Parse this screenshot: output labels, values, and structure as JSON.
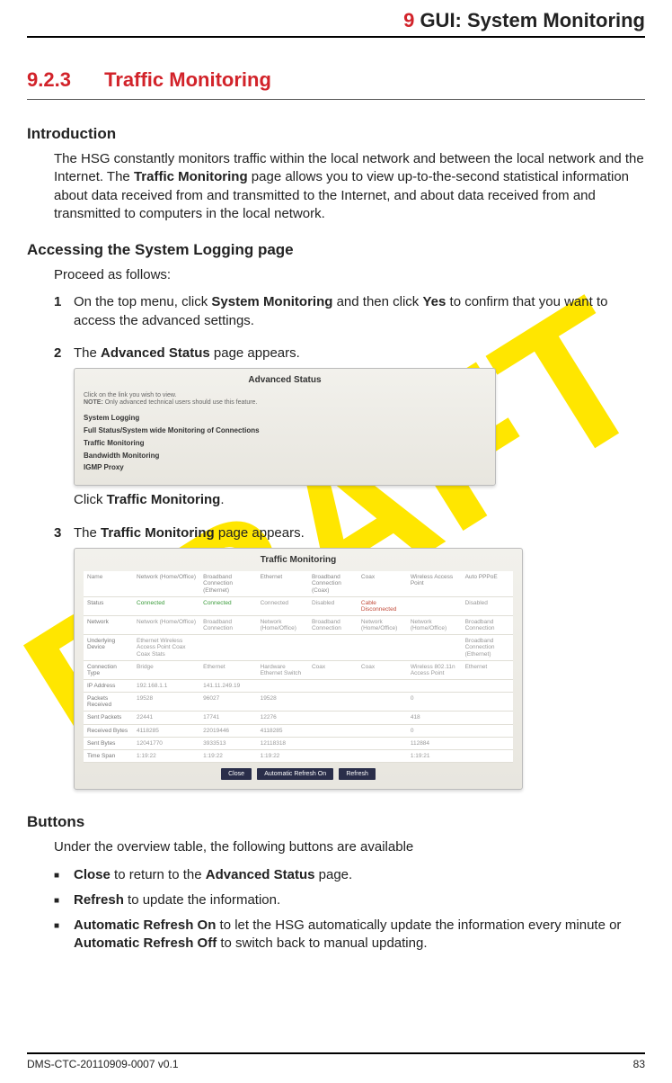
{
  "watermark": "DRAFT",
  "chapter": {
    "num": "9",
    "title": "GUI: System Monitoring"
  },
  "section": {
    "num": "9.2.3",
    "title": "Traffic Monitoring"
  },
  "intro": {
    "heading": "Introduction",
    "p1a": "The HSG constantly monitors traffic within the local network and between the local network and the Internet. The ",
    "p1b": "Traffic Monitoring",
    "p1c": " page allows you to view up-to-the-second statistical information about data received from and transmitted to the Internet, and about data received from and transmitted to computers in the local network."
  },
  "accessing": {
    "heading": "Accessing the System Logging page",
    "lead": "Proceed as follows:",
    "step1a": "On the top menu, click ",
    "step1b": "System Monitoring",
    "step1c": " and then click ",
    "step1d": "Yes",
    "step1e": " to confirm that you want to access the advanced settings.",
    "step2a": "The ",
    "step2b": "Advanced Status",
    "step2c": " page appears.",
    "step2click_a": "Click ",
    "step2click_b": "Traffic Monitoring",
    "step2click_c": ".",
    "step3a": "The ",
    "step3b": "Traffic Monitoring",
    "step3c": " page appears."
  },
  "screenshot1": {
    "title": "Advanced Status",
    "note_pre": "Click on the link you wish to view.",
    "note_label": "NOTE:",
    "note_text": " Only advanced technical users should use this feature.",
    "links": [
      "System Logging",
      "Full Status/System wide Monitoring of Connections",
      "Traffic Monitoring",
      "Bandwidth Monitoring",
      "IGMP Proxy"
    ]
  },
  "screenshot2": {
    "title": "Traffic Monitoring",
    "headers": [
      "Name",
      "Network (Home/Office)",
      "Broadband Connection (Ethernet)",
      "Ethernet",
      "Broadband Connection (Coax)",
      "Coax",
      "Wireless Access Point",
      "Auto PPPoE"
    ],
    "rows": [
      {
        "label": "Status",
        "cells": [
          "Connected",
          "Connected",
          "Connected",
          "Disabled",
          "Cable Disconnected",
          "",
          "Disabled"
        ],
        "greenIdx": [
          0,
          1
        ],
        "redIdx": [
          4
        ]
      },
      {
        "label": "Network",
        "cells": [
          "Network (Home/Office)",
          "Broadband Connection",
          "Network (Home/Office)",
          "Broadband Connection",
          "Network (Home/Office)",
          "Network (Home/Office)",
          "Broadband Connection"
        ]
      },
      {
        "label": "Underlying Device",
        "cells": [
          "Ethernet Wireless Access Point Coax Coax Stats",
          "",
          "",
          "",
          "",
          "",
          "Broadband Connection (Ethernet)"
        ]
      },
      {
        "label": "Connection Type",
        "cells": [
          "Bridge",
          "Ethernet",
          "Hardware Ethernet Switch",
          "Coax",
          "Coax",
          "Wireless 802.11n Access Point",
          "Ethernet"
        ]
      },
      {
        "label": "IP Address",
        "cells": [
          "192.168.1.1",
          "141.11.249.19",
          "",
          "",
          "",
          "",
          ""
        ]
      },
      {
        "label": "Packets Received",
        "cells": [
          "19528",
          "96027",
          "19528",
          "",
          "",
          "0",
          ""
        ]
      },
      {
        "label": "Sent Packets",
        "cells": [
          "22441",
          "17741",
          "12276",
          "",
          "",
          "418",
          ""
        ]
      },
      {
        "label": "Received Bytes",
        "cells": [
          "4118285",
          "22019446",
          "4118285",
          "",
          "",
          "0",
          ""
        ]
      },
      {
        "label": "Sent Bytes",
        "cells": [
          "12041770",
          "3933513",
          "12118318",
          "",
          "",
          "112884",
          ""
        ]
      },
      {
        "label": "Time Span",
        "cells": [
          "1:19:22",
          "1:19:22",
          "1:19:22",
          "",
          "",
          "1:19:21",
          ""
        ]
      }
    ],
    "buttons": [
      "Close",
      "Automatic Refresh On",
      "Refresh"
    ]
  },
  "buttons_section": {
    "heading": "Buttons",
    "lead": "Under the overview table, the following buttons are available",
    "b1a": "Close",
    "b1b": " to return to the ",
    "b1c": "Advanced Status",
    "b1d": " page.",
    "b2a": "Refresh",
    "b2b": " to update the information.",
    "b3a": "Automatic Refresh On",
    "b3b": " to let the HSG automatically update the information every minute or ",
    "b3c": "Automatic Refresh Off",
    "b3d": " to switch back to manual updating."
  },
  "footer": {
    "doc": "DMS-CTC-20110909-0007 v0.1",
    "page": "83"
  }
}
